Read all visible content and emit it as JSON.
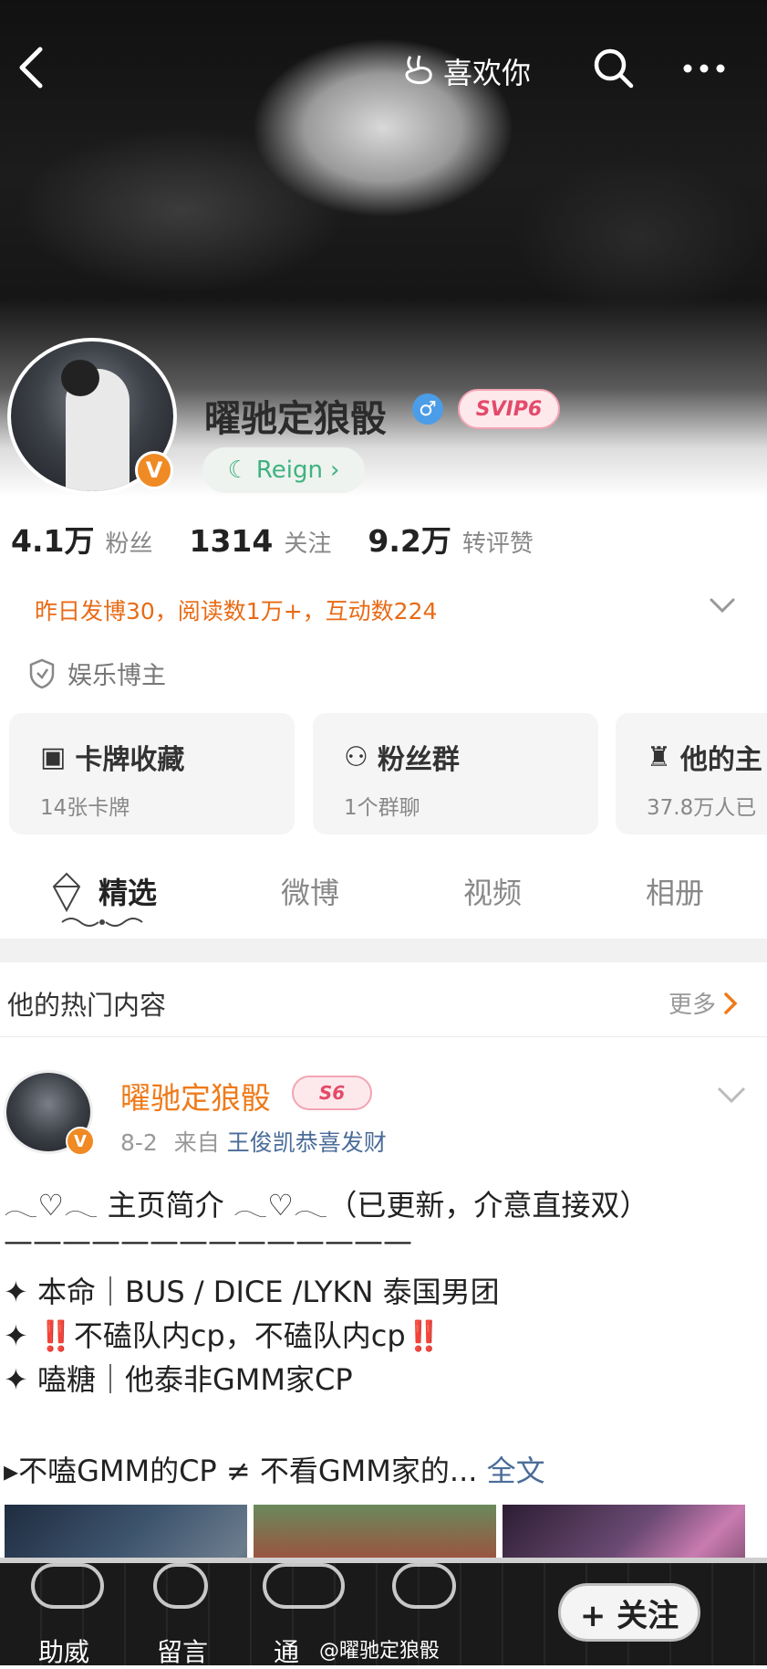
{
  "topbar": {
    "like_label": "喜欢你"
  },
  "profile": {
    "name": "曜驰定狼骰",
    "svip": "SVIP6",
    "reign_label": "Reign",
    "verified": "V"
  },
  "stats": [
    {
      "value": "4.1万",
      "label": "粉丝"
    },
    {
      "value": "1314",
      "label": "关注"
    },
    {
      "value": "9.2万",
      "label": "转评赞"
    }
  ],
  "activity": "昨日发博30，阅读数1万+，互动数224",
  "category": "娱乐博主",
  "cards": [
    {
      "title": "卡牌收藏",
      "sub": "14张卡牌"
    },
    {
      "title": "粉丝群",
      "sub": "1个群聊"
    },
    {
      "title": "他的主",
      "sub": "37.8万人已"
    }
  ],
  "tabs": [
    "精选",
    "微博",
    "视频",
    "相册"
  ],
  "hot": {
    "title": "他的热门内容",
    "more": "更多"
  },
  "post": {
    "name": "曜驰定狼骰",
    "badge": "S6",
    "date": "8-2",
    "from": "来自",
    "source": "王俊凯恭喜发财",
    "lines": [
      "𓂃♡𓂃 主页简介 𓂃♡𓂃（已更新，介意直接双）",
      "——————————————",
      "✦ 本命｜BUS / DICE /LYKN 泰国男团",
      "✦ ",
      "✦ 嗑糖｜他泰非GMM家CP"
    ],
    "red_line": {
      "mark": "‼️",
      "text": "不磕队内cp，不磕队内cp"
    },
    "last_line": "▸不嗑GMM的CP ≠ 不看GMM家的...",
    "fulltext": "全文"
  },
  "bottom": {
    "items": [
      "助威",
      "留言",
      "通"
    ],
    "follow": "+ 关注",
    "watermark": "@曜驰定狼骰"
  }
}
